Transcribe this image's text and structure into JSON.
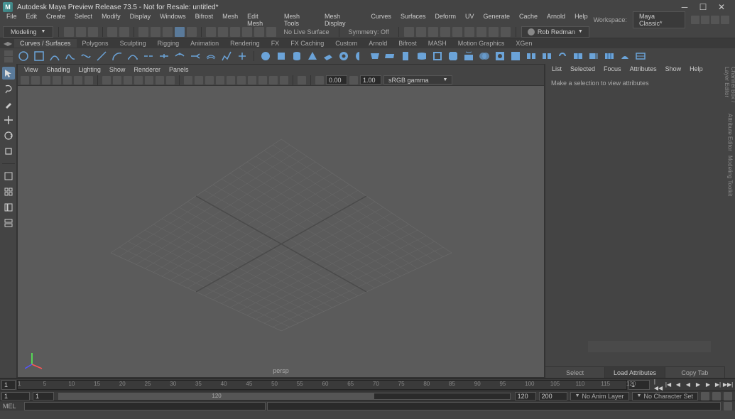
{
  "titlebar": {
    "title": "Autodesk Maya Preview Release 73.5 - Not for Resale: untitled*"
  },
  "menubar": {
    "items": [
      "File",
      "Edit",
      "Create",
      "Select",
      "Modify",
      "Display",
      "Windows",
      "Bifrost",
      "Mesh",
      "Edit Mesh",
      "Mesh Tools",
      "Mesh Display",
      "Curves",
      "Surfaces",
      "Deform",
      "UV",
      "Generate",
      "Cache",
      "Arnold",
      "Help"
    ],
    "workspace_label": "Workspace:",
    "workspace_value": "Maya Classic*"
  },
  "shelf_row": {
    "mode": "Modeling",
    "no_live_surface": "No Live Surface",
    "symmetry": "Symmetry: Off",
    "user": "Rob Redman"
  },
  "shelf_tabs": [
    "Curves / Surfaces",
    "Polygons",
    "Sculpting",
    "Rigging",
    "Animation",
    "Rendering",
    "FX",
    "FX Caching",
    "Custom",
    "Arnold",
    "Bifrost",
    "MASH",
    "Motion Graphics",
    "XGen"
  ],
  "panel_menus": [
    "View",
    "Shading",
    "Lighting",
    "Show",
    "Renderer",
    "Panels"
  ],
  "panel_toolbar": {
    "val1": "0.00",
    "val2": "1.00",
    "colorspace": "sRGB gamma"
  },
  "viewport": {
    "camera": "persp"
  },
  "attr_panel": {
    "menus": [
      "List",
      "Selected",
      "Focus",
      "Attributes",
      "Show",
      "Help"
    ],
    "message": "Make a selection to view attributes",
    "btn_select": "Select",
    "btn_load": "Load Attributes",
    "btn_copy": "Copy Tab"
  },
  "right_tabs": [
    "Channel Box / Layer Editor",
    "Attribute Editor",
    "Modeling Toolkit"
  ],
  "timeline": {
    "start": "1",
    "ticks": [
      "1",
      "5",
      "10",
      "15",
      "20",
      "25",
      "30",
      "35",
      "40",
      "45",
      "50",
      "55",
      "60",
      "65",
      "70",
      "75",
      "80",
      "85",
      "90",
      "95",
      "100",
      "105",
      "110",
      "115",
      "120"
    ],
    "current": "1"
  },
  "range": {
    "start": "1",
    "range_start": "1",
    "range_label": "120",
    "range_end": "120",
    "end": "200",
    "anim_layer": "No Anim Layer",
    "char_set": "No Character Set"
  },
  "cmd": {
    "label": "MEL"
  }
}
